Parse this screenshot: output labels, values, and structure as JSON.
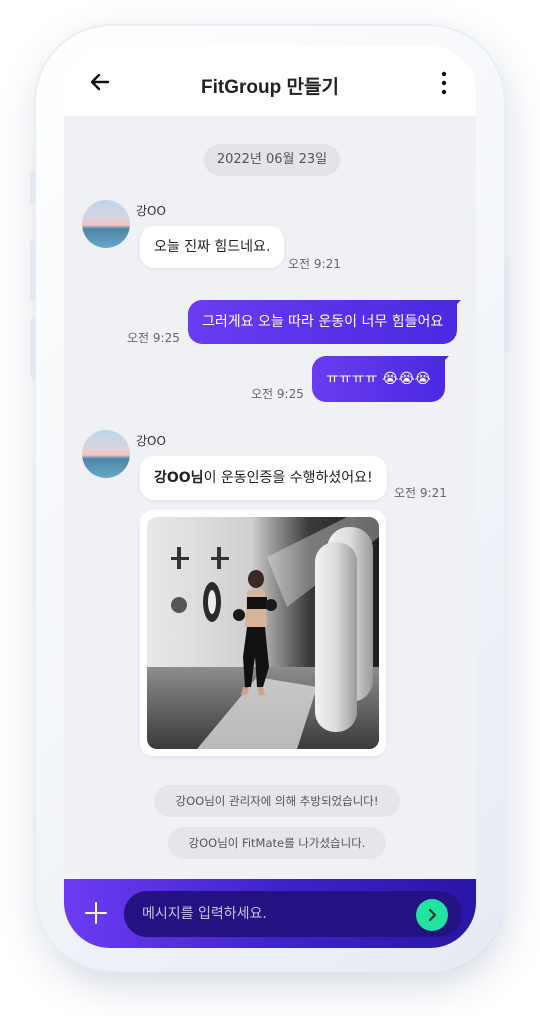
{
  "header": {
    "title": "FitGroup 만들기"
  },
  "date_separator": "2022년 06월 23일",
  "messages": [
    {
      "sender": "강OO",
      "text": "오늘 진짜 힘드네요.",
      "time": "오전 9:21"
    },
    {
      "text": "그러게요 오늘 따라 운동이 너무 힘들어요",
      "time": "오전 9:25"
    },
    {
      "text": "ㅠㅠㅠㅠ 😭😭😭",
      "time": "오전 9:25"
    },
    {
      "sender": "강OO",
      "bold": "강OO님",
      "text": "이 운동인증을 수행하셨어요!",
      "time": "오전 9:21"
    }
  ],
  "system_messages": [
    "강OO님이 관리자에 의해 추방되었습니다!",
    "강OO님이 FitMate를 나가셨습니다."
  ],
  "composer": {
    "placeholder": "메시지를 입력하세요."
  },
  "colors": {
    "accent": "#5b33ea",
    "send": "#22e3a0",
    "background": "#f0f1f5"
  },
  "icons": {
    "back": "arrow-left-icon",
    "menu": "more-vertical-icon",
    "attach": "plus-icon",
    "send": "chevron-right-icon"
  }
}
